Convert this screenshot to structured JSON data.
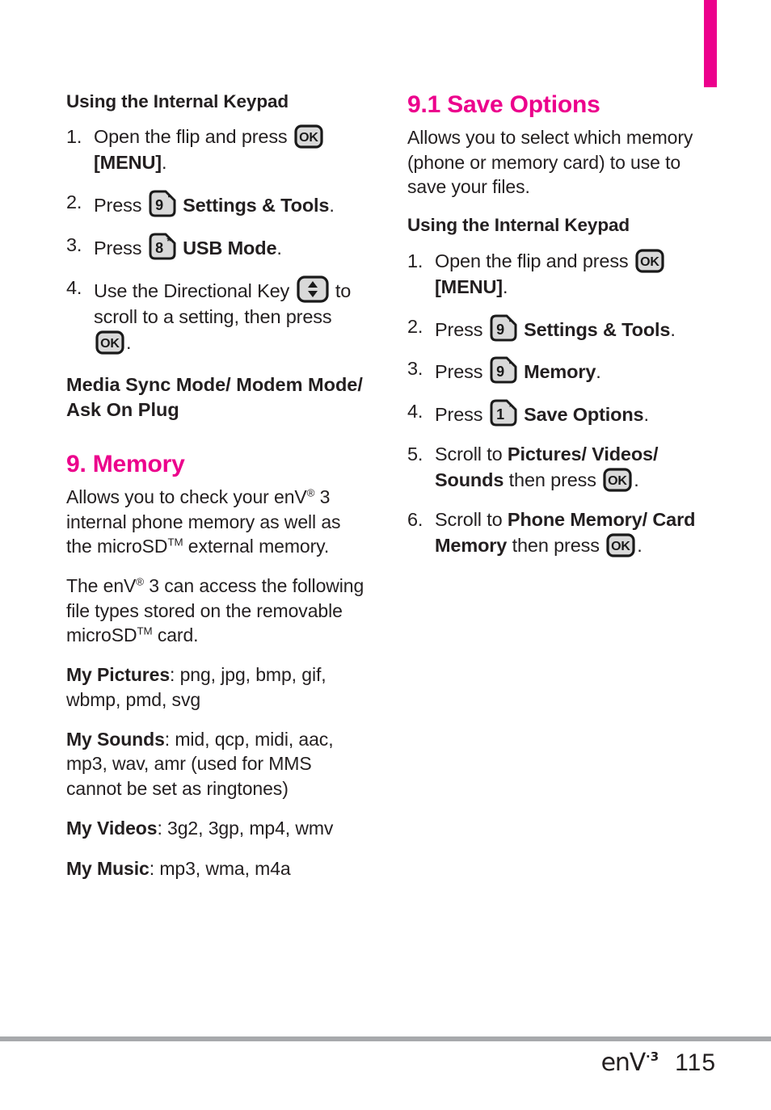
{
  "page": {
    "number": "115",
    "brand": "enV",
    "brand_superscript": "·3",
    "accent_color": "#ec008c",
    "rule_color": "#a7a9ac",
    "text_color": "#231f20"
  },
  "left_column": {
    "subheading": "Using the Internal Keypad",
    "steps": [
      {
        "number": "1.",
        "parts": [
          {
            "type": "text",
            "value": "Open the flip and press "
          },
          {
            "type": "icon",
            "value": "ok-key-icon"
          },
          {
            "type": "bold",
            "value": " [MENU]"
          },
          {
            "type": "text",
            "value": "."
          }
        ]
      },
      {
        "number": "2.",
        "parts": [
          {
            "type": "text",
            "value": "Press "
          },
          {
            "type": "icon",
            "value": "key-9-icon"
          },
          {
            "type": "bold",
            "value": " Settings & Tools"
          },
          {
            "type": "text",
            "value": "."
          }
        ]
      },
      {
        "number": "3.",
        "parts": [
          {
            "type": "text",
            "value": "Press "
          },
          {
            "type": "icon",
            "value": "key-8-icon"
          },
          {
            "type": "bold",
            "value": " USB Mode"
          },
          {
            "type": "text",
            "value": "."
          }
        ]
      },
      {
        "number": "4.",
        "parts": [
          {
            "type": "text",
            "value": "Use the Directional Key "
          },
          {
            "type": "icon",
            "value": "directional-key-icon"
          },
          {
            "type": "text",
            "value": " to scroll to a setting, then press "
          },
          {
            "type": "icon",
            "value": "ok-key-icon"
          },
          {
            "type": "text",
            "value": "."
          }
        ]
      }
    ],
    "step4_note": "Media Sync Mode/ Modem Mode/ Ask On Plug",
    "section": {
      "title": "9. Memory",
      "paragraph_1": {
        "before": "Allows you to check your enV",
        "sup_1": "®",
        "middle": " 3 internal phone memory as well as the microSD",
        "sup_2": "TM",
        "after": " external memory."
      },
      "paragraph_2": {
        "before": "The enV",
        "sup_1": "®",
        "middle": " 3 can access the following file types stored on the removable microSD",
        "sup_2": "TM",
        "after": " card."
      },
      "file_types": [
        {
          "label": "My Pictures",
          "value": ": png, jpg, bmp, gif, wbmp, pmd, svg"
        },
        {
          "label": "My Sounds",
          "value": ": mid, qcp, midi, aac, mp3, wav, amr (used for MMS cannot be set as ringtones)"
        },
        {
          "label": "My Videos",
          "value": ": 3g2, 3gp, mp4, wmv"
        },
        {
          "label": "My Music",
          "value": ": mp3, wma, m4a"
        }
      ]
    }
  },
  "right_column": {
    "section_title": "9.1 Save Options",
    "intro": "Allows you to select which memory (phone or memory card) to use to save your files.",
    "subheading": "Using the Internal Keypad",
    "steps": [
      {
        "number": "1.",
        "parts": [
          {
            "type": "text",
            "value": "Open the flip and press "
          },
          {
            "type": "icon",
            "value": "ok-key-icon"
          },
          {
            "type": "bold",
            "value": " [MENU]"
          },
          {
            "type": "text",
            "value": "."
          }
        ]
      },
      {
        "number": "2.",
        "parts": [
          {
            "type": "text",
            "value": "Press "
          },
          {
            "type": "icon",
            "value": "key-9-icon"
          },
          {
            "type": "bold",
            "value": " Settings & Tools"
          },
          {
            "type": "text",
            "value": "."
          }
        ]
      },
      {
        "number": "3.",
        "parts": [
          {
            "type": "text",
            "value": "Press "
          },
          {
            "type": "icon",
            "value": "key-9-icon"
          },
          {
            "type": "bold",
            "value": " Memory"
          },
          {
            "type": "text",
            "value": "."
          }
        ]
      },
      {
        "number": "4.",
        "parts": [
          {
            "type": "text",
            "value": "Press "
          },
          {
            "type": "icon",
            "value": "key-1-icon"
          },
          {
            "type": "bold",
            "value": " Save Options"
          },
          {
            "type": "text",
            "value": "."
          }
        ]
      },
      {
        "number": "5.",
        "parts": [
          {
            "type": "text",
            "value": "Scroll to "
          },
          {
            "type": "bold",
            "value": "Pictures/ Videos/ Sounds"
          },
          {
            "type": "text",
            "value": " then press "
          },
          {
            "type": "icon",
            "value": "ok-key-icon"
          },
          {
            "type": "text",
            "value": "."
          }
        ]
      },
      {
        "number": "6.",
        "parts": [
          {
            "type": "text",
            "value": "Scroll to "
          },
          {
            "type": "bold",
            "value": "Phone Memory/ Card Memory"
          },
          {
            "type": "text",
            "value": " then press "
          },
          {
            "type": "icon",
            "value": "ok-key-icon"
          },
          {
            "type": "text",
            "value": "."
          }
        ]
      }
    ]
  },
  "icons": {
    "ok-key-icon": {
      "label": "OK"
    },
    "key-9-icon": {
      "label": "9",
      "mark": "‘"
    },
    "key-8-icon": {
      "label": "8",
      "mark": "*"
    },
    "key-1-icon": {
      "label": "1",
      "mark": "’"
    },
    "directional-key-icon": {
      "label": "up-down arrows"
    }
  }
}
